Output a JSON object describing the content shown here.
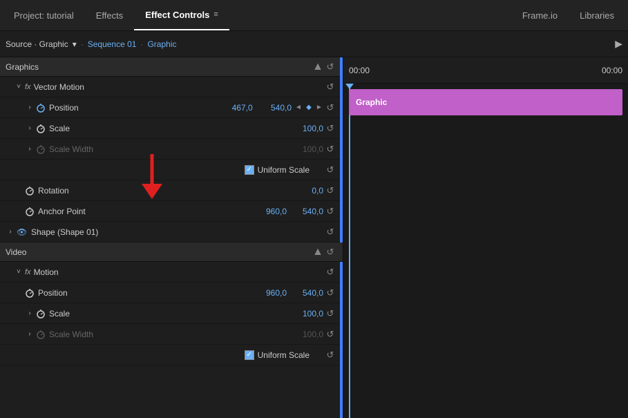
{
  "tabs": [
    {
      "id": "project",
      "label": "Project: tutorial",
      "active": false
    },
    {
      "id": "effects",
      "label": "Effects",
      "active": false
    },
    {
      "id": "effect-controls",
      "label": "Effect Controls",
      "active": true
    },
    {
      "id": "frameio",
      "label": "Frame.io",
      "active": false
    },
    {
      "id": "libraries",
      "label": "Libraries",
      "active": false
    }
  ],
  "tab_menu_icon": "≡",
  "source_bar": {
    "label": "Source · Graphic",
    "dropdown_icon": "▾",
    "sequence": "Sequence 01",
    "separator": "·",
    "clip": "Graphic",
    "play_icon": "▶"
  },
  "sections": {
    "graphics": {
      "label": "Graphics",
      "scroll_up": "▲"
    },
    "video": {
      "label": "Video",
      "scroll_up": "▲"
    }
  },
  "graphics_section": {
    "fx_label": "fx",
    "effect_name": "Vector Motion",
    "properties": [
      {
        "name": "Position",
        "value1": "467,0",
        "value2": "540,0",
        "has_keyframe": true,
        "dimmed": false,
        "expanded": true
      },
      {
        "name": "Scale",
        "value1": "100,0",
        "value2": null,
        "has_keyframe": false,
        "dimmed": false,
        "expanded": false
      },
      {
        "name": "Scale Width",
        "value1": "100,0",
        "value2": null,
        "has_keyframe": false,
        "dimmed": true,
        "expanded": false
      }
    ],
    "uniform_scale_label": "Uniform Scale",
    "rotation": {
      "name": "Rotation",
      "value": "0,0"
    },
    "anchor_point": {
      "name": "Anchor Point",
      "value1": "960,0",
      "value2": "540,0"
    },
    "shape_label": "Shape (Shape 01)"
  },
  "video_section": {
    "fx_label": "fx",
    "effect_name": "Motion",
    "properties": [
      {
        "name": "Position",
        "value1": "960,0",
        "value2": "540,0",
        "has_keyframe": false
      },
      {
        "name": "Scale",
        "value1": "100,0",
        "value2": null,
        "has_keyframe": false,
        "expanded": false
      },
      {
        "name": "Scale Width",
        "value1": "100,0",
        "value2": null,
        "dimmed": true,
        "expanded": false
      }
    ],
    "uniform_scale_label": "Uniform Scale"
  },
  "timeline": {
    "timecode_start": "00:00",
    "timecode_end": "00:00",
    "graphic_label": "Graphic"
  },
  "icons": {
    "stopwatch": "⏱",
    "reset": "↺",
    "expand_right": "›",
    "eye": "●",
    "check": "✓",
    "left_arrow": "◄",
    "right_arrow": "►",
    "keyframe": "◆"
  }
}
